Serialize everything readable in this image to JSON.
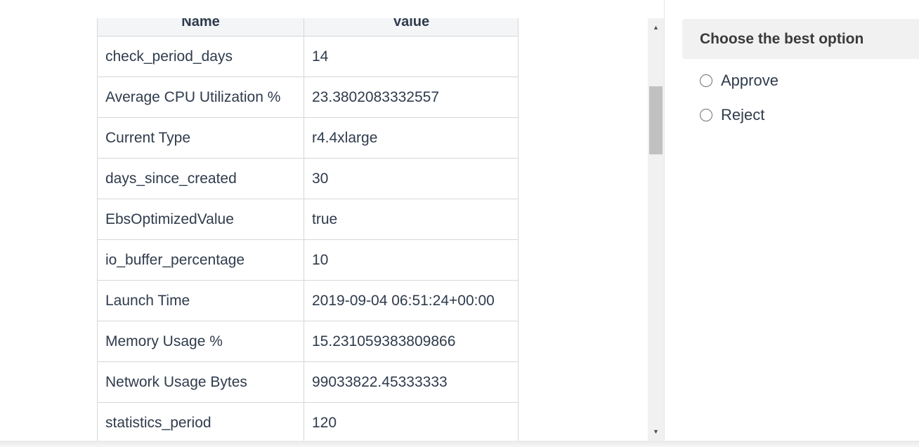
{
  "table": {
    "headers": [
      "Name",
      "Value"
    ],
    "rows": [
      {
        "name": "check_period_days",
        "value": "14"
      },
      {
        "name": "Average CPU Utilization %",
        "value": "23.3802083332557"
      },
      {
        "name": "Current Type",
        "value": "r4.4xlarge"
      },
      {
        "name": "days_since_created",
        "value": "30"
      },
      {
        "name": "EbsOptimizedValue",
        "value": "true"
      },
      {
        "name": "io_buffer_percentage",
        "value": "10"
      },
      {
        "name": "Launch Time",
        "value": "2019-09-04 06:51:24+00:00"
      },
      {
        "name": "Memory Usage %",
        "value": "15.231059383809866"
      },
      {
        "name": "Network Usage Bytes",
        "value": "99033822.45333333"
      },
      {
        "name": "statistics_period",
        "value": "120"
      }
    ]
  },
  "scrollbar": {
    "up_glyph": "▲",
    "down_glyph": "▼"
  },
  "question": {
    "title": "Choose the best option",
    "options": [
      {
        "label": "Approve",
        "selected": false
      },
      {
        "label": "Reject",
        "selected": false
      }
    ]
  }
}
